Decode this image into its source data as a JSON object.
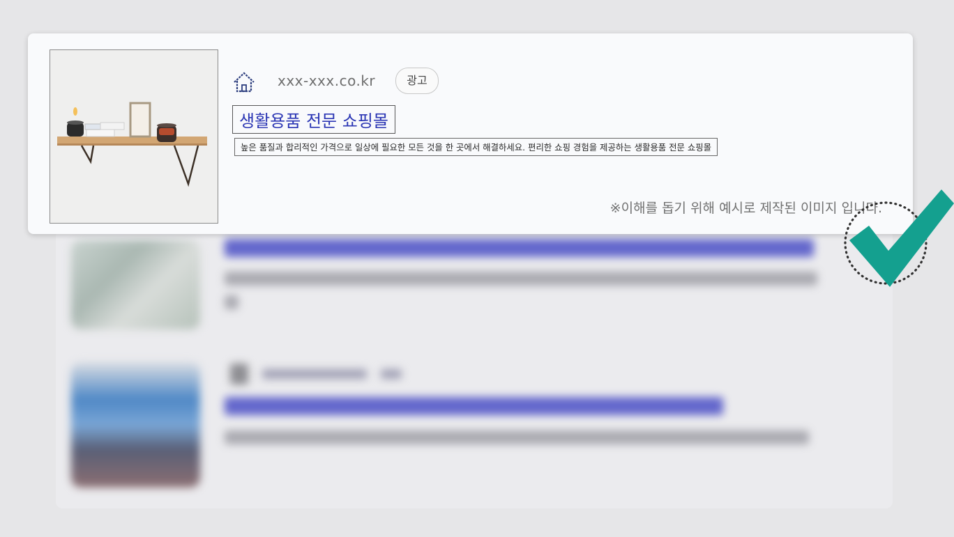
{
  "ad": {
    "url": "xxx-xxx.co.kr",
    "badge": "광고",
    "title": "생활용품 전문 쇼핑몰",
    "description": "높은 품질과 합리적인 가격으로 일상에 필요한 모든 것을 한 곳에서 해결하세요. 편리한 쇼핑 경험을 제공하는 생활용품 전문 쇼핑몰",
    "note": "※이해를 돕기 위해 예시로 제작된 이미지 입니다."
  },
  "colors": {
    "title": "#2b36b4",
    "checkmark": "#14a08f",
    "blurred_title": "#4c50c6"
  },
  "icons": {
    "site_icon": "house-icon",
    "approval_mark": "checkmark-icon"
  }
}
